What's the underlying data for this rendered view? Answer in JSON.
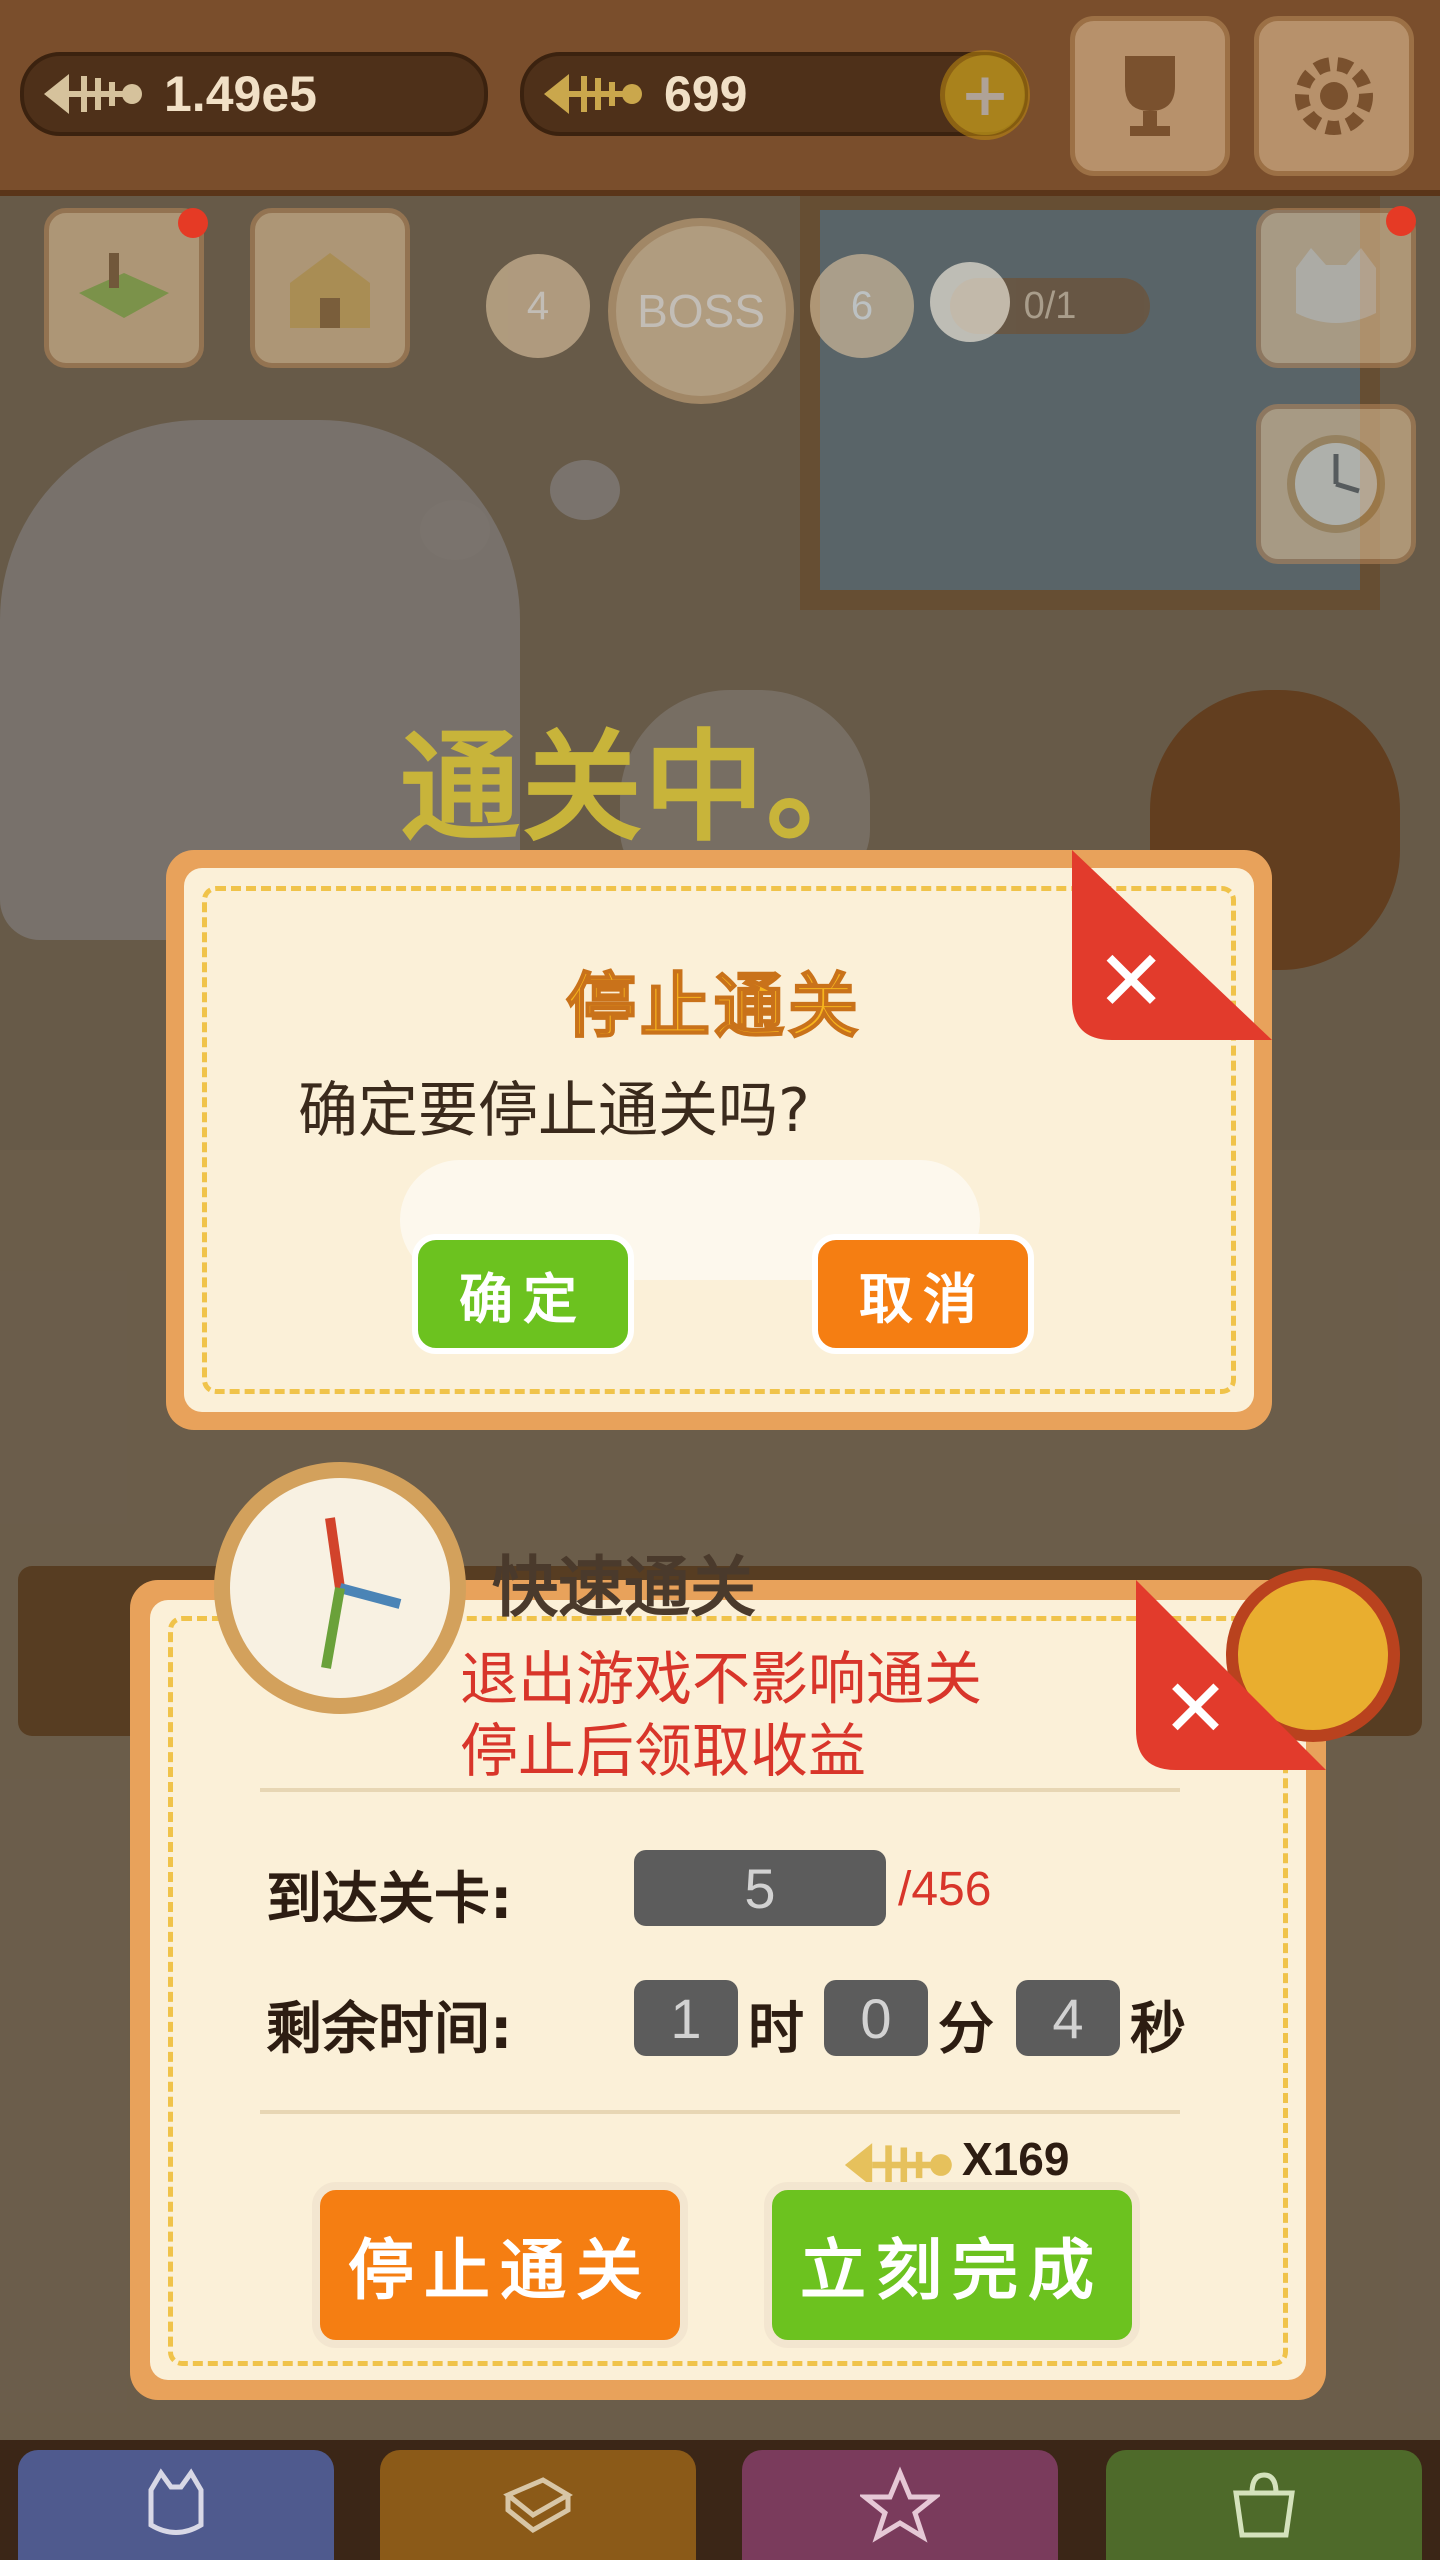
{
  "header": {
    "fishbone_count": "1.49e5",
    "golden_fish_count": "699"
  },
  "stage_bar": {
    "prev_stage": "4",
    "boss_label": "BOSS",
    "next_stage": "6",
    "quest_progress": "0/1"
  },
  "status_banner": "通关中。",
  "confirm_dialog": {
    "title": "停止通关",
    "message": "确定要停止通关吗?",
    "confirm_label": "确定",
    "cancel_label": "取消"
  },
  "quick_pass_panel": {
    "title": "快速通关",
    "note_line1": "退出游戏不影响通关",
    "note_line2": "停止后领取收益",
    "reach_label": "到达关卡:",
    "reach_value": "5",
    "reach_total": "/456",
    "remaining_label": "剩余时间:",
    "hours": "1",
    "hours_unit": "时",
    "minutes": "0",
    "minutes_unit": "分",
    "seconds": "4",
    "seconds_unit": "秒",
    "cost": "X169",
    "stop_label": "停止通关",
    "finish_label": "立刻完成"
  },
  "colors": {
    "accent_green": "#6cc21f",
    "accent_orange": "#f57e12",
    "close_red": "#e23b2c",
    "title_yellow": "#f7b51d"
  }
}
